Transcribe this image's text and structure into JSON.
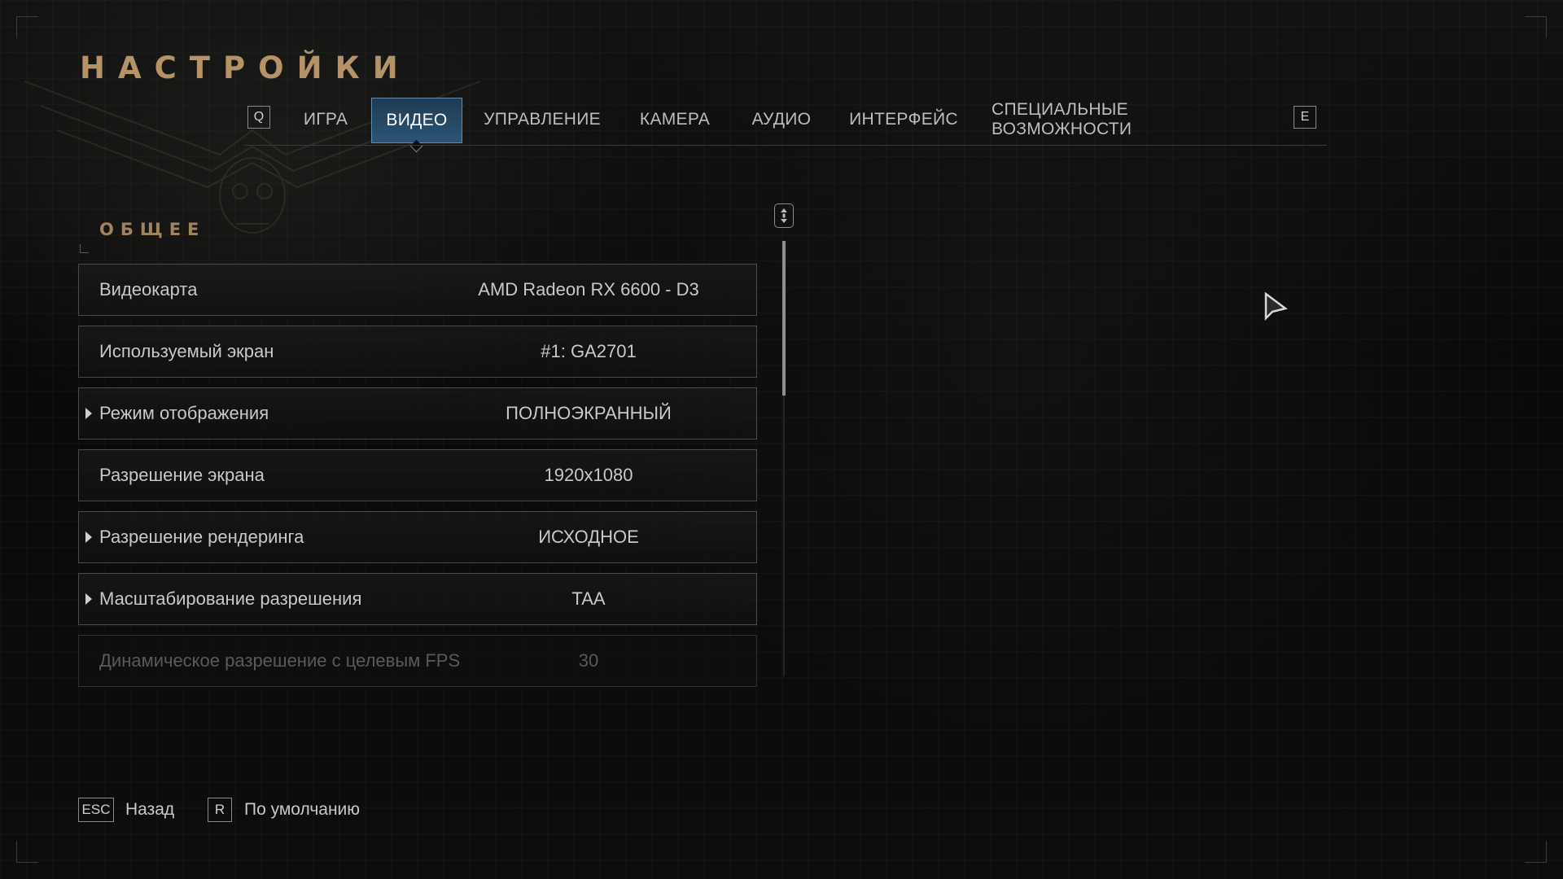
{
  "header": {
    "title": "НАСТРОЙКИ"
  },
  "tabs": {
    "prev_key": "Q",
    "next_key": "E",
    "items": [
      {
        "label": "ИГРА",
        "active": false
      },
      {
        "label": "ВИДЕО",
        "active": true
      },
      {
        "label": "УПРАВЛЕНИЕ",
        "active": false
      },
      {
        "label": "КАМЕРА",
        "active": false
      },
      {
        "label": "АУДИО",
        "active": false
      },
      {
        "label": "ИНТЕРФЕЙС",
        "active": false
      },
      {
        "label": "СПЕЦИАЛЬНЫЕ ВОЗМОЖНОСТИ",
        "active": false
      }
    ]
  },
  "section": {
    "title": "ОБЩЕЕ"
  },
  "settings": [
    {
      "label": "Видеокарта",
      "value": "AMD Radeon RX 6600 - D3",
      "expandable": false,
      "disabled": false
    },
    {
      "label": "Используемый экран",
      "value": "#1: GA2701",
      "expandable": false,
      "disabled": false
    },
    {
      "label": "Режим отображения",
      "value": "ПОЛНОЭКРАННЫЙ",
      "expandable": true,
      "disabled": false
    },
    {
      "label": "Разрешение экрана",
      "value": "1920x1080",
      "expandable": false,
      "disabled": false
    },
    {
      "label": "Разрешение рендеринга",
      "value": "ИСХОДНОЕ",
      "expandable": true,
      "disabled": false
    },
    {
      "label": "Масштабирование разрешения",
      "value": "TAA",
      "expandable": true,
      "disabled": false
    },
    {
      "label": "Динамическое разрешение с целевым FPS",
      "value": "30",
      "expandable": false,
      "disabled": true
    }
  ],
  "footer": {
    "back_key": "ESC",
    "back_label": "Назад",
    "default_key": "R",
    "default_label": "По умолчанию"
  },
  "colors": {
    "title": "#b59367",
    "active_tab": "#2b5575",
    "background": "#0b0b0b"
  },
  "icons": {
    "scroll": "mouse-scroll-icon",
    "cursor": "mouse-cursor-icon",
    "expand": "triangle-right-icon"
  }
}
